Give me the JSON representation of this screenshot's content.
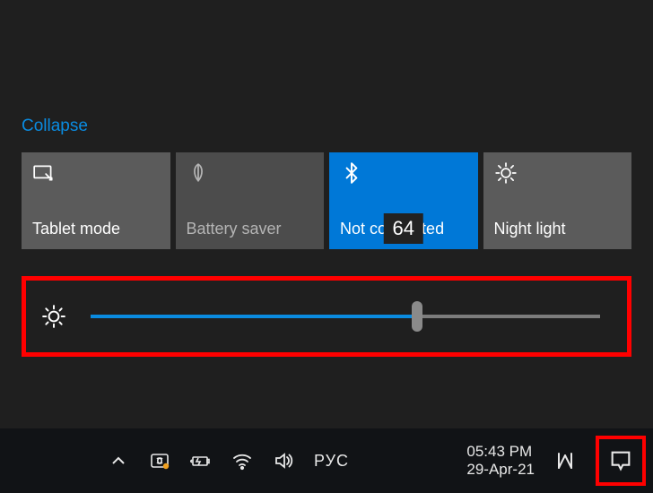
{
  "action_center": {
    "collapse_label": "Collapse",
    "tiles": [
      {
        "id": "tablet-mode",
        "label": "Tablet mode",
        "state": "normal"
      },
      {
        "id": "battery-saver",
        "label": "Battery saver",
        "state": "disabled"
      },
      {
        "id": "bluetooth",
        "label": "Not connected",
        "state": "active"
      },
      {
        "id": "night-light",
        "label": "Night light",
        "state": "normal"
      }
    ],
    "brightness": {
      "value": 64,
      "min": 0,
      "max": 100
    }
  },
  "taskbar": {
    "language": "РУС",
    "clock": {
      "time": "05:43 PM",
      "date": "29-Apr-21"
    }
  },
  "colors": {
    "accent": "#0078d7",
    "link": "#0a8be0",
    "highlight_border": "#ff0000"
  }
}
